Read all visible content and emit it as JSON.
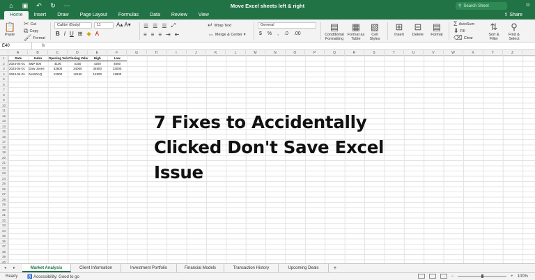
{
  "window": {
    "title": "Move Excel sheets left & right",
    "search_placeholder": "Search Sheet",
    "share_label": "Share"
  },
  "quick_access": [
    "home-icon",
    "save-icon",
    "undo-icon",
    "redo-icon",
    "more-icon"
  ],
  "tabs": [
    "Home",
    "Insert",
    "Draw",
    "Page Layout",
    "Formulas",
    "Data",
    "Review",
    "View"
  ],
  "ribbon": {
    "paste": "Paste",
    "cut": "Cut",
    "copy": "Copy",
    "format_painter": "Format",
    "font_name": "Calibri (Body)",
    "font_size": "11",
    "wrap_text": "Wrap Text",
    "merge_center": "Merge & Center",
    "number_format": "General",
    "conditional_formatting": "Conditional Formatting",
    "format_as_table": "Format as Table",
    "cell_styles": "Cell Styles",
    "insert": "Insert",
    "delete": "Delete",
    "format": "Format",
    "autosum": "AutoSum",
    "fill": "Fill",
    "clear": "Clear",
    "sort_filter": "Sort & Filter",
    "find_select": "Find & Select"
  },
  "formula_bar": {
    "name_box": "E40",
    "fx": "fx"
  },
  "columns": [
    "A",
    "B",
    "C",
    "D",
    "E",
    "F",
    "G",
    "H",
    "I",
    "J",
    "K",
    "L",
    "M",
    "N",
    "O",
    "P",
    "Q",
    "R",
    "S",
    "T",
    "U",
    "V",
    "W",
    "X",
    "Y",
    "Z"
  ],
  "rows": [
    "1",
    "2",
    "3",
    "4",
    "5",
    "6",
    "7",
    "8",
    "9",
    "10",
    "11",
    "12",
    "13",
    "14",
    "15",
    "16",
    "17",
    "18",
    "19",
    "20",
    "21",
    "22",
    "23",
    "24",
    "25",
    "26",
    "27",
    "28",
    "29",
    "30",
    "31",
    "32",
    "33",
    "34",
    "35",
    "36",
    "37",
    "38",
    "39",
    "40"
  ],
  "table": {
    "headers": [
      "Date",
      "Index",
      "Opening Value",
      "Closing Value",
      "High",
      "Low"
    ],
    "rows": [
      [
        "2024-04-01",
        "S&P 500",
        "4100",
        "4150",
        "4200",
        "4050"
      ],
      [
        "2024-04-01",
        "Dow Jones",
        "33500",
        "34000",
        "34500",
        "33000"
      ],
      [
        "2024-04-01",
        "NASDAQ",
        "12000",
        "12150",
        "12200",
        "11900"
      ]
    ]
  },
  "overlay_text": {
    "line1": "7 Fixes to Accidentally",
    "line2": "Clicked Don't Save Excel",
    "line3": "Issue"
  },
  "sheets": [
    "Market Analysis",
    "Client Information",
    "Investment Portfolio",
    "Financial Models",
    "Transaction History",
    "Upcoming Deals"
  ],
  "active_sheet": "Market Analysis",
  "status": {
    "ready": "Ready",
    "accessibility": "Accessibility: Good to go",
    "zoom": "100%"
  },
  "colors": {
    "brand": "#217346"
  }
}
